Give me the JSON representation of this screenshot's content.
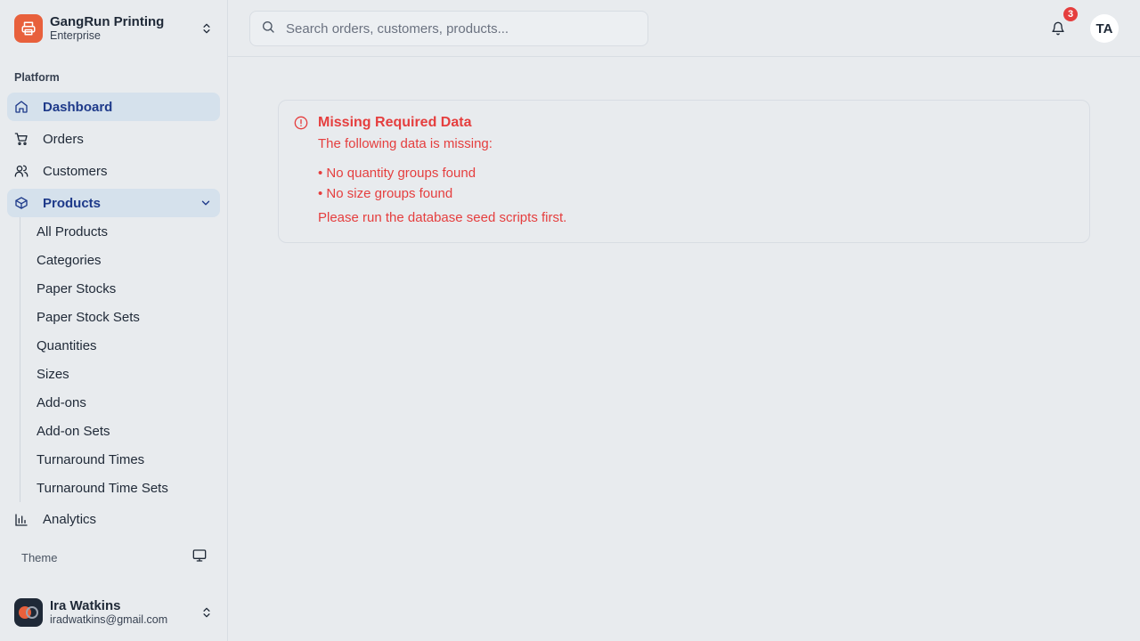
{
  "brand": {
    "name": "GangRun Printing",
    "plan": "Enterprise"
  },
  "sidebar": {
    "group_label": "Platform",
    "items": [
      {
        "label": "Dashboard",
        "icon": "home-icon",
        "active": true
      },
      {
        "label": "Orders",
        "icon": "cart-icon",
        "active": false
      },
      {
        "label": "Customers",
        "icon": "users-icon",
        "active": false
      },
      {
        "label": "Products",
        "icon": "box-icon",
        "active": true,
        "expanded": true
      }
    ],
    "products_sub": [
      "All Products",
      "Categories",
      "Paper Stocks",
      "Paper Stock Sets",
      "Quantities",
      "Sizes",
      "Add-ons",
      "Add-on Sets",
      "Turnaround Times",
      "Turnaround Time Sets"
    ],
    "analytics_label": "Analytics",
    "theme_label": "Theme"
  },
  "user": {
    "name": "Ira Watkins",
    "email": "iradwatkins@gmail.com",
    "initials": "TA"
  },
  "header": {
    "search_placeholder": "Search orders, customers, products...",
    "notification_count": "3"
  },
  "alert": {
    "title": "Missing Required Data",
    "description": "The following data is missing:",
    "items": [
      "• No quantity groups found",
      "• No size groups found"
    ],
    "footer": "Please run the database seed scripts first.",
    "color": "#e53e3e"
  },
  "colors": {
    "brand": "#e8603c",
    "active_bg": "#d5e1ec",
    "active_text": "#1e3a8a",
    "danger": "#e53e3e"
  }
}
